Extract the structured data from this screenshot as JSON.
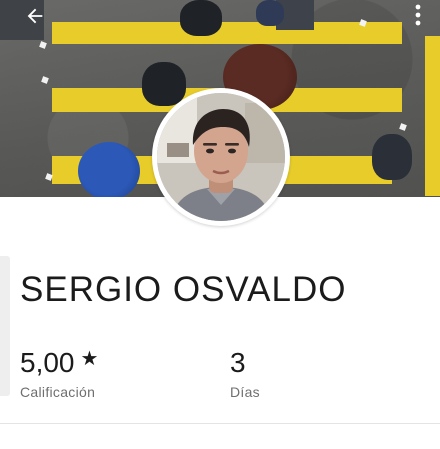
{
  "header": {
    "back_icon": "arrow-left-icon",
    "menu_icon": "more-vertical-icon"
  },
  "profile": {
    "name": "SERGIO OSVALDO"
  },
  "stats": {
    "rating": {
      "value": "5,00",
      "icon": "star-icon",
      "label": "Calificación"
    },
    "days": {
      "value": "3",
      "label": "Días"
    }
  },
  "colors": {
    "stripe_yellow": "#e8cd2a",
    "text_primary": "#1b1b1b",
    "text_secondary": "#6f6f6f"
  }
}
